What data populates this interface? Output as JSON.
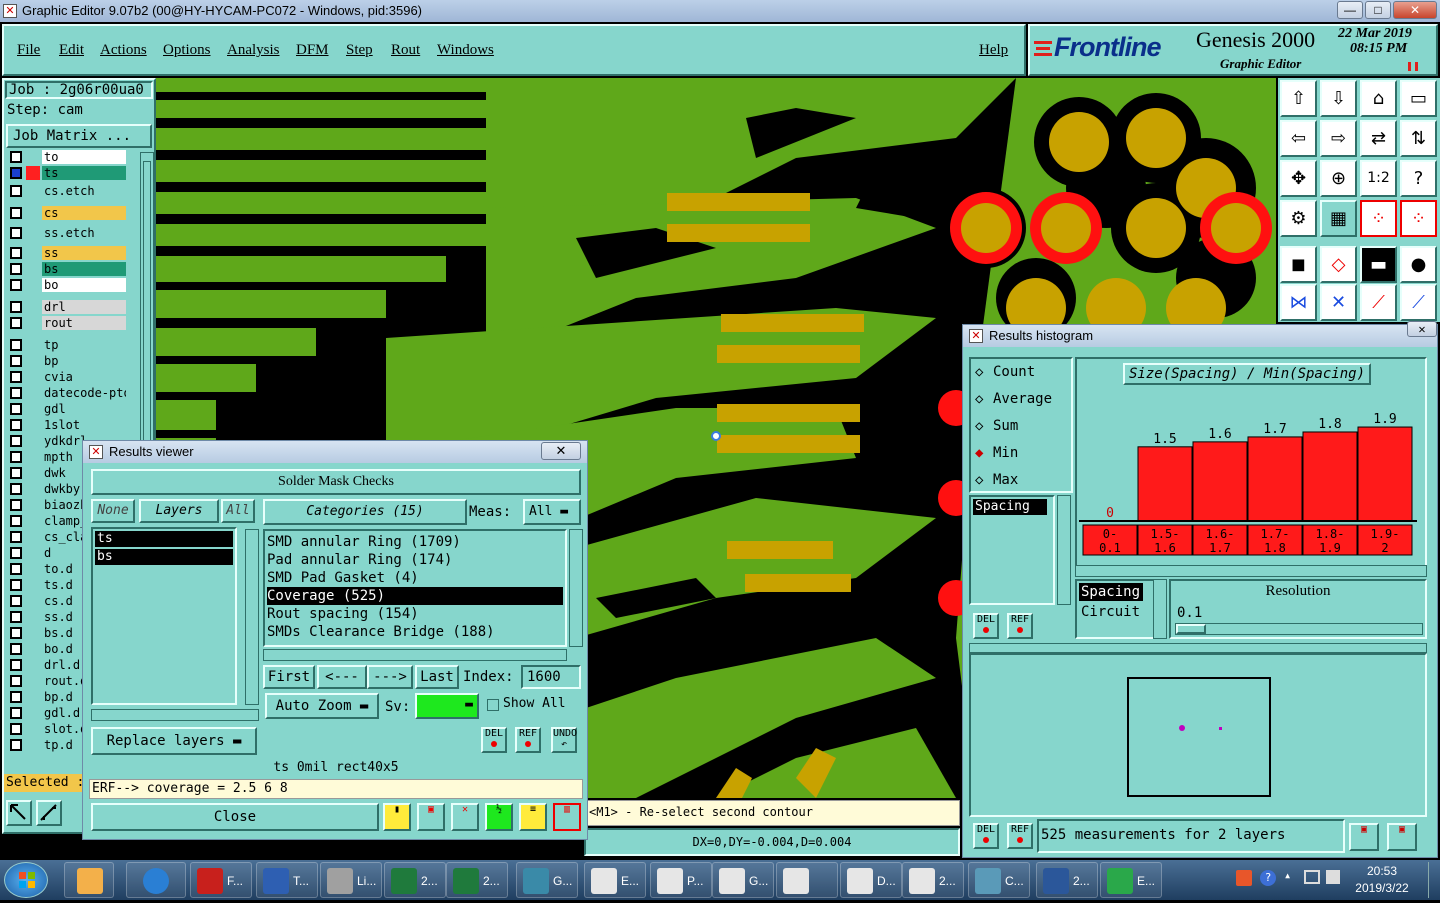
{
  "title_bar": {
    "text": "Graphic Editor 9.07b2 (00@HY-HYCAM-PC072 - Windows, pid:3596)",
    "buttons": [
      "—",
      "□",
      "✕"
    ]
  },
  "menu": {
    "items": [
      "File",
      "Edit",
      "Actions",
      "Options",
      "Analysis",
      "DFM",
      "Step",
      "Rout",
      "Windows"
    ],
    "help": "Help"
  },
  "brand": {
    "logo": "Frontline",
    "product": "Genesis 2000",
    "subtitle": "Graphic Editor",
    "date": "22 Mar 2019",
    "time": "08:15 PM"
  },
  "job": {
    "job_label": "Job : 2g06r00ua0",
    "step_label": "Step: cam",
    "matrix_button": "Job Matrix ...",
    "selected": "Selected :"
  },
  "layers": [
    {
      "name": "to",
      "color": "#ffffff"
    },
    {
      "name": "ts",
      "color": "#1f9a76",
      "active": true
    },
    {
      "name": "cs.etch",
      "color": "#86d6cc"
    },
    {
      "name": "cs",
      "color": "#f2c64a"
    },
    {
      "name": "ss.etch",
      "color": "#86d6cc"
    },
    {
      "name": "ss",
      "color": "#f2c64a"
    },
    {
      "name": "bs",
      "color": "#1f9a76"
    },
    {
      "name": "bo",
      "color": "#ffffff"
    },
    {
      "name": "drl",
      "color": "#d7d7d7"
    },
    {
      "name": "rout",
      "color": "#d7d7d7"
    },
    {
      "name": "tp",
      "color": "#86d6cc"
    },
    {
      "name": "bp",
      "color": "#86d6cc"
    },
    {
      "name": "cvia",
      "color": "#86d6cc"
    },
    {
      "name": "datecode-pto",
      "color": "#86d6cc"
    },
    {
      "name": "gdl",
      "color": "#86d6cc"
    },
    {
      "name": "1slot",
      "color": "#86d6cc"
    },
    {
      "name": "ydkdrl",
      "color": "#86d6cc"
    },
    {
      "name": "mpth",
      "color": "#86d6cc"
    },
    {
      "name": "dwk",
      "color": "#86d6cc"
    },
    {
      "name": "dwkby",
      "color": "#86d6cc"
    },
    {
      "name": "biaozh",
      "color": "#86d6cc"
    },
    {
      "name": "clamp_",
      "color": "#86d6cc"
    },
    {
      "name": "cs_cla",
      "color": "#86d6cc"
    },
    {
      "name": "d",
      "color": "#86d6cc"
    },
    {
      "name": "to.d",
      "color": "#86d6cc"
    },
    {
      "name": "ts.d",
      "color": "#86d6cc"
    },
    {
      "name": "cs.d",
      "color": "#86d6cc"
    },
    {
      "name": "ss.d",
      "color": "#86d6cc"
    },
    {
      "name": "bs.d",
      "color": "#86d6cc"
    },
    {
      "name": "bo.d",
      "color": "#86d6cc"
    },
    {
      "name": "drl.d",
      "color": "#86d6cc"
    },
    {
      "name": "rout.d",
      "color": "#86d6cc"
    },
    {
      "name": "bp.d",
      "color": "#86d6cc"
    },
    {
      "name": "gdl.d",
      "color": "#86d6cc"
    },
    {
      "name": "slot.d",
      "color": "#86d6cc"
    },
    {
      "name": "tp.d",
      "color": "#86d6cc"
    }
  ],
  "status": {
    "prompt": "<M1> - Re-select second contour",
    "coords": "DX=0,DY=-0.004,D=0.004"
  },
  "results_viewer": {
    "title": "Results viewer",
    "header": "Solder Mask Checks",
    "none_btn": "None",
    "layers_btn": "Layers",
    "all_btn": "All",
    "layer_list": [
      "ts",
      "bs"
    ],
    "categories_btn": "Categories (15)",
    "meas_label": "Meas:",
    "meas_value": "All",
    "categories": [
      "SMD annular Ring (1709)",
      "Pad annular Ring (174)",
      "SMD Pad Gasket (4)",
      "Coverage (525)",
      "Rout spacing (154)",
      "SMDs Clearance Bridge (188)"
    ],
    "selected_category": 3,
    "nav": {
      "first": "First",
      "prev": "<---",
      "next": "--->",
      "last": "Last",
      "index_label": "Index:",
      "index_value": "1600"
    },
    "auto_zoom": "Auto Zoom",
    "sv_label": "Sv:",
    "show_all": "Show All",
    "replace_layers": "Replace layers",
    "icons": [
      "DEL",
      "REF",
      "UNDO"
    ],
    "info_line": "ts 0mil  rect40x5",
    "erf_line": "ERF--> coverage = 2.5 6 8",
    "close": "Close"
  },
  "histogram": {
    "title": "Results histogram",
    "modes": [
      "Count",
      "Average",
      "Sum",
      "Min",
      "Max"
    ],
    "selected_mode": "Min",
    "chart_title": "Size(Spacing) / Min(Spacing)",
    "list_item": "Spacing",
    "bottom_list": [
      "Spacing",
      "Circuit"
    ],
    "resolution_label": "Resolution",
    "resolution_value": "0.1",
    "icons": [
      "DEL",
      "REF"
    ],
    "summary": "525 measurements for 2 layers"
  },
  "chart_data": {
    "type": "bar",
    "title": "Size(Spacing) / Min(Spacing)",
    "categories": [
      "0-0.1",
      "1.5-1.6",
      "1.6-1.7",
      "1.7-1.8",
      "1.8-1.9",
      "1.9-2"
    ],
    "values": [
      0,
      1.5,
      1.6,
      1.7,
      1.8,
      1.9
    ],
    "data_labels": [
      "0",
      "1.5",
      "1.6",
      "1.7",
      "1.8",
      "1.9"
    ],
    "bar_color": "#ff1a1a",
    "ylim": [
      0,
      2.2
    ]
  },
  "taskbar": {
    "items": [
      "F...",
      "T...",
      "Li...",
      "2...",
      "2...",
      "G...",
      "E...",
      "P...",
      "G...",
      "",
      "D...",
      "2...",
      "C...",
      "2...",
      "E..."
    ],
    "clock_time": "20:53",
    "clock_date": "2019/3/22"
  }
}
